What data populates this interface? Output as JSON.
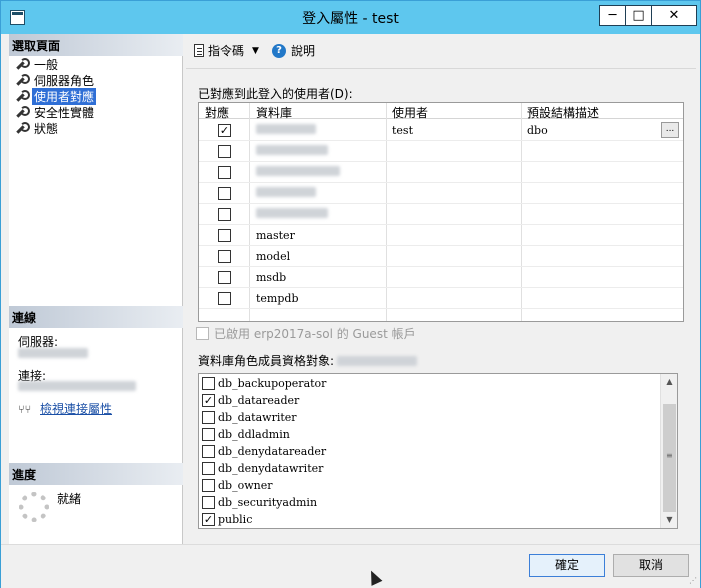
{
  "window": {
    "title": "登入屬性 - test",
    "minimize": "─",
    "maximize": "□",
    "close": "✕"
  },
  "left": {
    "select_page_header": "選取頁面",
    "nav": [
      {
        "label": "一般",
        "selected": false
      },
      {
        "label": "伺服器角色",
        "selected": false
      },
      {
        "label": "使用者對應",
        "selected": true
      },
      {
        "label": "安全性實體",
        "selected": false
      },
      {
        "label": "狀態",
        "selected": false
      }
    ],
    "connection_header": "連線",
    "server_label": "伺服器:",
    "connection_label": "連接:",
    "view_link": "檢視連接屬性",
    "progress_header": "進度",
    "ready": "就緒"
  },
  "toolbar": {
    "script": "指令碼",
    "help": "說明"
  },
  "users": {
    "label": "已對應到此登入的使用者(D):",
    "headers": [
      "對應",
      "資料庫",
      "使用者",
      "預設結構描述"
    ],
    "rows": [
      {
        "mapped": true,
        "database": "",
        "user": "test",
        "schema": "dbo",
        "blurred": true
      },
      {
        "mapped": false,
        "database": "",
        "user": "",
        "schema": "",
        "blurred": true
      },
      {
        "mapped": false,
        "database": "",
        "user": "",
        "schema": "",
        "blurred": true
      },
      {
        "mapped": false,
        "database": "",
        "user": "",
        "schema": "",
        "blurred": true
      },
      {
        "mapped": false,
        "database": "",
        "user": "",
        "schema": "",
        "blurred": true
      },
      {
        "mapped": false,
        "database": "master",
        "user": "",
        "schema": "",
        "blurred": false
      },
      {
        "mapped": false,
        "database": "model",
        "user": "",
        "schema": "",
        "blurred": false
      },
      {
        "mapped": false,
        "database": "msdb",
        "user": "",
        "schema": "",
        "blurred": false
      },
      {
        "mapped": false,
        "database": "tempdb",
        "user": "",
        "schema": "",
        "blurred": false
      }
    ],
    "ellipsis": "..."
  },
  "guest_label": "已啟用 erp2017a-sol 的 Guest 帳戶",
  "roles": {
    "label": "資料庫角色成員資格對象:",
    "items": [
      {
        "name": "db_backupoperator",
        "checked": false
      },
      {
        "name": "db_datareader",
        "checked": true
      },
      {
        "name": "db_datawriter",
        "checked": false
      },
      {
        "name": "db_ddladmin",
        "checked": false
      },
      {
        "name": "db_denydatareader",
        "checked": false
      },
      {
        "name": "db_denydatawriter",
        "checked": false
      },
      {
        "name": "db_owner",
        "checked": false
      },
      {
        "name": "db_securityadmin",
        "checked": false
      },
      {
        "name": "public",
        "checked": true
      }
    ]
  },
  "buttons": {
    "ok": "確定",
    "cancel": "取消"
  }
}
